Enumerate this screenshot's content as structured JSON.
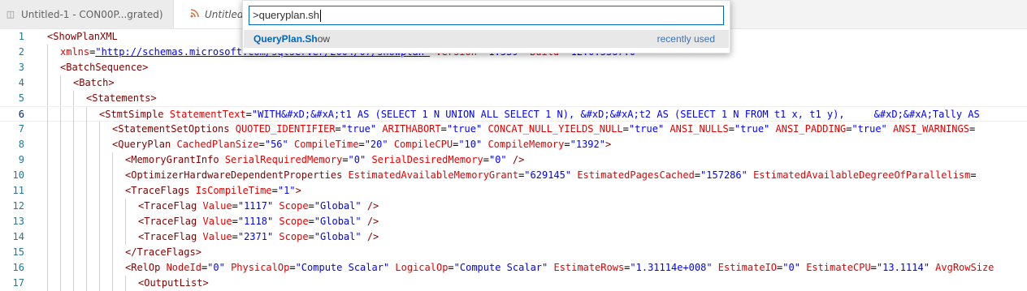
{
  "tabs": [
    {
      "label": "Untitled-1 - CON00P...grated)",
      "icon": "database-icon"
    },
    {
      "label": "Untitled-",
      "icon": "rss-icon"
    }
  ],
  "palette": {
    "input_value": ">queryplan.sh",
    "items": [
      {
        "match": "QueryPlan.Sh",
        "rest": "ow",
        "hint": "recently used"
      }
    ]
  },
  "editor": {
    "current_line": 6,
    "lines": [
      {
        "num": "1",
        "indent": 0,
        "tokens": [
          {
            "c": "t",
            "s": "<ShowPlanXML"
          }
        ]
      },
      {
        "num": "2",
        "indent": 1,
        "tokens": [
          {
            "c": "a",
            "s": "xmlns"
          },
          {
            "c": "p",
            "s": "="
          },
          {
            "c": "u",
            "s": "\"http://schemas.microsoft.com/sqlserver/2004/07/showplan\""
          },
          {
            "c": "a",
            "s": " Version"
          },
          {
            "c": "p",
            "s": "="
          },
          {
            "c": "v",
            "s": "\"1.539\""
          },
          {
            "c": "a",
            "s": " Build"
          },
          {
            "c": "p",
            "s": "="
          },
          {
            "c": "v",
            "s": "\"12.0.5367.0\""
          }
        ]
      },
      {
        "num": "3",
        "indent": 1,
        "tokens": [
          {
            "c": "t",
            "s": "<BatchSequence>"
          }
        ]
      },
      {
        "num": "4",
        "indent": 2,
        "tokens": [
          {
            "c": "t",
            "s": "<Batch>"
          }
        ]
      },
      {
        "num": "5",
        "indent": 3,
        "tokens": [
          {
            "c": "t",
            "s": "<Statements>"
          }
        ]
      },
      {
        "num": "6",
        "indent": 4,
        "tokens": [
          {
            "c": "t",
            "s": "<StmtSimple"
          },
          {
            "c": "a",
            "s": " StatementText"
          },
          {
            "c": "p",
            "s": "="
          },
          {
            "c": "v",
            "s": "\"WITH&#xD;&#xA;t1 AS (SELECT 1 N UNION ALL SELECT 1 N), &#xD;&#xA;t2 AS (SELECT 1 N FROM t1 x, t1 y),     &#xD;&#xA;Tally AS"
          }
        ]
      },
      {
        "num": "7",
        "indent": 5,
        "tokens": [
          {
            "c": "t",
            "s": "<StatementSetOptions"
          },
          {
            "c": "a",
            "s": " QUOTED_IDENTIFIER"
          },
          {
            "c": "p",
            "s": "="
          },
          {
            "c": "v",
            "s": "\"true\""
          },
          {
            "c": "a",
            "s": " ARITHABORT"
          },
          {
            "c": "p",
            "s": "="
          },
          {
            "c": "v",
            "s": "\"true\""
          },
          {
            "c": "a",
            "s": " CONCAT_NULL_YIELDS_NULL"
          },
          {
            "c": "p",
            "s": "="
          },
          {
            "c": "v",
            "s": "\"true\""
          },
          {
            "c": "a",
            "s": " ANSI_NULLS"
          },
          {
            "c": "p",
            "s": "="
          },
          {
            "c": "v",
            "s": "\"true\""
          },
          {
            "c": "a",
            "s": " ANSI_PADDING"
          },
          {
            "c": "p",
            "s": "="
          },
          {
            "c": "v",
            "s": "\"true\""
          },
          {
            "c": "a",
            "s": " ANSI_WARNINGS"
          },
          {
            "c": "p",
            "s": "="
          }
        ]
      },
      {
        "num": "8",
        "indent": 5,
        "tokens": [
          {
            "c": "t",
            "s": "<QueryPlan"
          },
          {
            "c": "a",
            "s": " CachedPlanSize"
          },
          {
            "c": "p",
            "s": "="
          },
          {
            "c": "v",
            "s": "\"56\""
          },
          {
            "c": "a",
            "s": " CompileTime"
          },
          {
            "c": "p",
            "s": "="
          },
          {
            "c": "v",
            "s": "\"20\""
          },
          {
            "c": "a",
            "s": " CompileCPU"
          },
          {
            "c": "p",
            "s": "="
          },
          {
            "c": "v",
            "s": "\"10\""
          },
          {
            "c": "a",
            "s": " CompileMemory"
          },
          {
            "c": "p",
            "s": "="
          },
          {
            "c": "v",
            "s": "\"1392\""
          },
          {
            "c": "t",
            "s": ">"
          }
        ]
      },
      {
        "num": "9",
        "indent": 6,
        "tokens": [
          {
            "c": "t",
            "s": "<MemoryGrantInfo"
          },
          {
            "c": "a",
            "s": " SerialRequiredMemory"
          },
          {
            "c": "p",
            "s": "="
          },
          {
            "c": "v",
            "s": "\"0\""
          },
          {
            "c": "a",
            "s": " SerialDesiredMemory"
          },
          {
            "c": "p",
            "s": "="
          },
          {
            "c": "v",
            "s": "\"0\""
          },
          {
            "c": "t",
            "s": " />"
          }
        ]
      },
      {
        "num": "10",
        "indent": 6,
        "tokens": [
          {
            "c": "t",
            "s": "<OptimizerHardwareDependentProperties"
          },
          {
            "c": "a",
            "s": " EstimatedAvailableMemoryGrant"
          },
          {
            "c": "p",
            "s": "="
          },
          {
            "c": "v",
            "s": "\"629145\""
          },
          {
            "c": "a",
            "s": " EstimatedPagesCached"
          },
          {
            "c": "p",
            "s": "="
          },
          {
            "c": "v",
            "s": "\"157286\""
          },
          {
            "c": "a",
            "s": " EstimatedAvailableDegreeOfParallelism"
          },
          {
            "c": "p",
            "s": "="
          }
        ]
      },
      {
        "num": "11",
        "indent": 6,
        "tokens": [
          {
            "c": "t",
            "s": "<TraceFlags"
          },
          {
            "c": "a",
            "s": " IsCompileTime"
          },
          {
            "c": "p",
            "s": "="
          },
          {
            "c": "v",
            "s": "\"1\""
          },
          {
            "c": "t",
            "s": ">"
          }
        ]
      },
      {
        "num": "12",
        "indent": 7,
        "tokens": [
          {
            "c": "t",
            "s": "<TraceFlag"
          },
          {
            "c": "a",
            "s": " Value"
          },
          {
            "c": "p",
            "s": "="
          },
          {
            "c": "v",
            "s": "\"1117\""
          },
          {
            "c": "a",
            "s": " Scope"
          },
          {
            "c": "p",
            "s": "="
          },
          {
            "c": "v",
            "s": "\"Global\""
          },
          {
            "c": "t",
            "s": " />"
          }
        ]
      },
      {
        "num": "13",
        "indent": 7,
        "tokens": [
          {
            "c": "t",
            "s": "<TraceFlag"
          },
          {
            "c": "a",
            "s": " Value"
          },
          {
            "c": "p",
            "s": "="
          },
          {
            "c": "v",
            "s": "\"1118\""
          },
          {
            "c": "a",
            "s": " Scope"
          },
          {
            "c": "p",
            "s": "="
          },
          {
            "c": "v",
            "s": "\"Global\""
          },
          {
            "c": "t",
            "s": " />"
          }
        ]
      },
      {
        "num": "14",
        "indent": 7,
        "tokens": [
          {
            "c": "t",
            "s": "<TraceFlag"
          },
          {
            "c": "a",
            "s": " Value"
          },
          {
            "c": "p",
            "s": "="
          },
          {
            "c": "v",
            "s": "\"2371\""
          },
          {
            "c": "a",
            "s": " Scope"
          },
          {
            "c": "p",
            "s": "="
          },
          {
            "c": "v",
            "s": "\"Global\""
          },
          {
            "c": "t",
            "s": " />"
          }
        ]
      },
      {
        "num": "15",
        "indent": 6,
        "tokens": [
          {
            "c": "t",
            "s": "</TraceFlags>"
          }
        ]
      },
      {
        "num": "16",
        "indent": 6,
        "tokens": [
          {
            "c": "t",
            "s": "<RelOp"
          },
          {
            "c": "a",
            "s": " NodeId"
          },
          {
            "c": "p",
            "s": "="
          },
          {
            "c": "v",
            "s": "\"0\""
          },
          {
            "c": "a",
            "s": " PhysicalOp"
          },
          {
            "c": "p",
            "s": "="
          },
          {
            "c": "v",
            "s": "\"Compute Scalar\""
          },
          {
            "c": "a",
            "s": " LogicalOp"
          },
          {
            "c": "p",
            "s": "="
          },
          {
            "c": "v",
            "s": "\"Compute Scalar\""
          },
          {
            "c": "a",
            "s": " EstimateRows"
          },
          {
            "c": "p",
            "s": "="
          },
          {
            "c": "v",
            "s": "\"1.31114e+008\""
          },
          {
            "c": "a",
            "s": " EstimateIO"
          },
          {
            "c": "p",
            "s": "="
          },
          {
            "c": "v",
            "s": "\"0\""
          },
          {
            "c": "a",
            "s": " EstimateCPU"
          },
          {
            "c": "p",
            "s": "="
          },
          {
            "c": "v",
            "s": "\"13.1114\""
          },
          {
            "c": "a",
            "s": " AvgRowSize"
          }
        ]
      },
      {
        "num": "17",
        "indent": 7,
        "tokens": [
          {
            "c": "t",
            "s": "<OutputList>"
          }
        ]
      }
    ]
  }
}
